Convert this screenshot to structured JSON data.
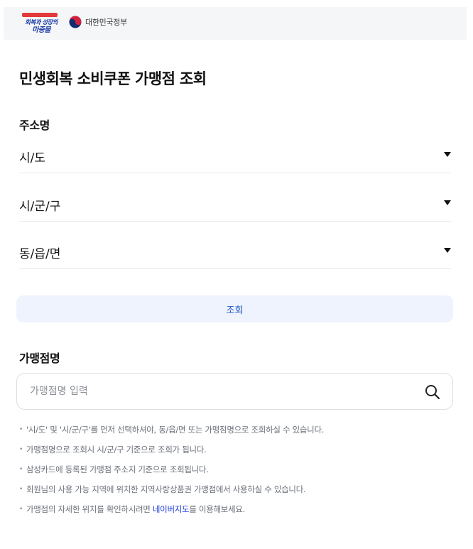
{
  "header": {
    "campaign_logo_text": "회복과 성장의 마중물",
    "gov_name": "대한민국정부"
  },
  "page_title": "민생회복 소비쿠폰 가맹점 조회",
  "address_section": {
    "label": "주소명",
    "sido": "시/도",
    "sigungu": "시/군/구",
    "dong": "동/읍/면"
  },
  "search_button": "조회",
  "store_section": {
    "label": "가맹점명",
    "placeholder": "가맹점명 입력"
  },
  "notes": {
    "n1": "'시/도' 및 '시/군/구'를 먼저 선택하셔야, 동/읍/면 또는 가맹점명으로 조회하실 수 있습니다.",
    "n2": "가맹점명으로 조회시 시/군/구 기준으로 조회가 됩니다.",
    "n3": "삼성카드에 등록된 가맹점 주소지 기준으로 조회됩니다.",
    "n4": "회원님의 사용 가능 지역에 위치한 지역사랑상품권 가맹점에서 사용하실 수 있습니다.",
    "n5_before": "가맹점의 자세한 위치를 확인하시려면 ",
    "n5_link": "네이버지도",
    "n5_after": "를 이용해보세요."
  },
  "icons": {
    "search": "search-icon",
    "caret": "caret-down-icon",
    "emblem": "taegeuk-emblem-icon"
  },
  "colors": {
    "accent_blue": "#1b54c9",
    "button_bg": "#eef3fd",
    "link_blue": "#1d3fd6"
  }
}
